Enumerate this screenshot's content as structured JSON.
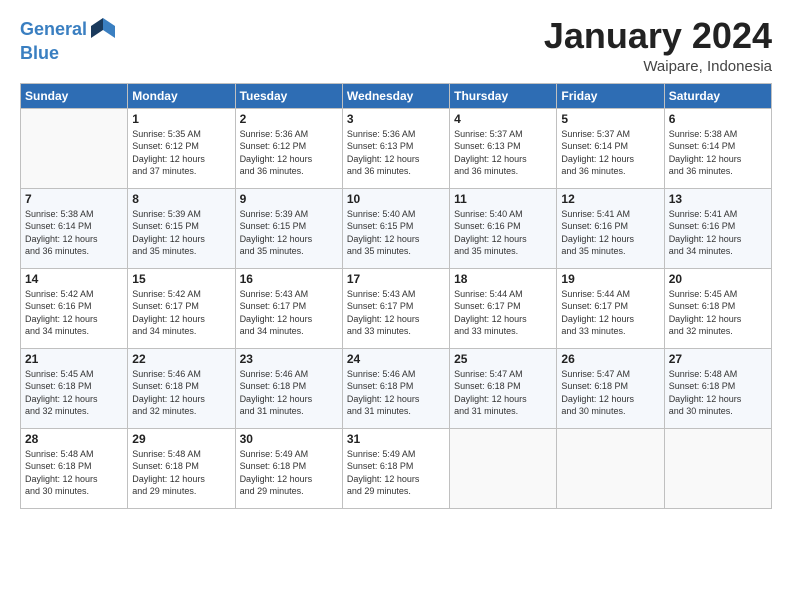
{
  "logo": {
    "line1": "General",
    "line2": "Blue"
  },
  "header": {
    "month": "January 2024",
    "location": "Waipare, Indonesia"
  },
  "days_of_week": [
    "Sunday",
    "Monday",
    "Tuesday",
    "Wednesday",
    "Thursday",
    "Friday",
    "Saturday"
  ],
  "weeks": [
    [
      {
        "day": "",
        "info": ""
      },
      {
        "day": "1",
        "info": "Sunrise: 5:35 AM\nSunset: 6:12 PM\nDaylight: 12 hours\nand 37 minutes."
      },
      {
        "day": "2",
        "info": "Sunrise: 5:36 AM\nSunset: 6:12 PM\nDaylight: 12 hours\nand 36 minutes."
      },
      {
        "day": "3",
        "info": "Sunrise: 5:36 AM\nSunset: 6:13 PM\nDaylight: 12 hours\nand 36 minutes."
      },
      {
        "day": "4",
        "info": "Sunrise: 5:37 AM\nSunset: 6:13 PM\nDaylight: 12 hours\nand 36 minutes."
      },
      {
        "day": "5",
        "info": "Sunrise: 5:37 AM\nSunset: 6:14 PM\nDaylight: 12 hours\nand 36 minutes."
      },
      {
        "day": "6",
        "info": "Sunrise: 5:38 AM\nSunset: 6:14 PM\nDaylight: 12 hours\nand 36 minutes."
      }
    ],
    [
      {
        "day": "7",
        "info": "Sunrise: 5:38 AM\nSunset: 6:14 PM\nDaylight: 12 hours\nand 36 minutes."
      },
      {
        "day": "8",
        "info": "Sunrise: 5:39 AM\nSunset: 6:15 PM\nDaylight: 12 hours\nand 35 minutes."
      },
      {
        "day": "9",
        "info": "Sunrise: 5:39 AM\nSunset: 6:15 PM\nDaylight: 12 hours\nand 35 minutes."
      },
      {
        "day": "10",
        "info": "Sunrise: 5:40 AM\nSunset: 6:15 PM\nDaylight: 12 hours\nand 35 minutes."
      },
      {
        "day": "11",
        "info": "Sunrise: 5:40 AM\nSunset: 6:16 PM\nDaylight: 12 hours\nand 35 minutes."
      },
      {
        "day": "12",
        "info": "Sunrise: 5:41 AM\nSunset: 6:16 PM\nDaylight: 12 hours\nand 35 minutes."
      },
      {
        "day": "13",
        "info": "Sunrise: 5:41 AM\nSunset: 6:16 PM\nDaylight: 12 hours\nand 34 minutes."
      }
    ],
    [
      {
        "day": "14",
        "info": "Sunrise: 5:42 AM\nSunset: 6:16 PM\nDaylight: 12 hours\nand 34 minutes."
      },
      {
        "day": "15",
        "info": "Sunrise: 5:42 AM\nSunset: 6:17 PM\nDaylight: 12 hours\nand 34 minutes."
      },
      {
        "day": "16",
        "info": "Sunrise: 5:43 AM\nSunset: 6:17 PM\nDaylight: 12 hours\nand 34 minutes."
      },
      {
        "day": "17",
        "info": "Sunrise: 5:43 AM\nSunset: 6:17 PM\nDaylight: 12 hours\nand 33 minutes."
      },
      {
        "day": "18",
        "info": "Sunrise: 5:44 AM\nSunset: 6:17 PM\nDaylight: 12 hours\nand 33 minutes."
      },
      {
        "day": "19",
        "info": "Sunrise: 5:44 AM\nSunset: 6:17 PM\nDaylight: 12 hours\nand 33 minutes."
      },
      {
        "day": "20",
        "info": "Sunrise: 5:45 AM\nSunset: 6:18 PM\nDaylight: 12 hours\nand 32 minutes."
      }
    ],
    [
      {
        "day": "21",
        "info": "Sunrise: 5:45 AM\nSunset: 6:18 PM\nDaylight: 12 hours\nand 32 minutes."
      },
      {
        "day": "22",
        "info": "Sunrise: 5:46 AM\nSunset: 6:18 PM\nDaylight: 12 hours\nand 32 minutes."
      },
      {
        "day": "23",
        "info": "Sunrise: 5:46 AM\nSunset: 6:18 PM\nDaylight: 12 hours\nand 31 minutes."
      },
      {
        "day": "24",
        "info": "Sunrise: 5:46 AM\nSunset: 6:18 PM\nDaylight: 12 hours\nand 31 minutes."
      },
      {
        "day": "25",
        "info": "Sunrise: 5:47 AM\nSunset: 6:18 PM\nDaylight: 12 hours\nand 31 minutes."
      },
      {
        "day": "26",
        "info": "Sunrise: 5:47 AM\nSunset: 6:18 PM\nDaylight: 12 hours\nand 30 minutes."
      },
      {
        "day": "27",
        "info": "Sunrise: 5:48 AM\nSunset: 6:18 PM\nDaylight: 12 hours\nand 30 minutes."
      }
    ],
    [
      {
        "day": "28",
        "info": "Sunrise: 5:48 AM\nSunset: 6:18 PM\nDaylight: 12 hours\nand 30 minutes."
      },
      {
        "day": "29",
        "info": "Sunrise: 5:48 AM\nSunset: 6:18 PM\nDaylight: 12 hours\nand 29 minutes."
      },
      {
        "day": "30",
        "info": "Sunrise: 5:49 AM\nSunset: 6:18 PM\nDaylight: 12 hours\nand 29 minutes."
      },
      {
        "day": "31",
        "info": "Sunrise: 5:49 AM\nSunset: 6:18 PM\nDaylight: 12 hours\nand 29 minutes."
      },
      {
        "day": "",
        "info": ""
      },
      {
        "day": "",
        "info": ""
      },
      {
        "day": "",
        "info": ""
      }
    ]
  ]
}
